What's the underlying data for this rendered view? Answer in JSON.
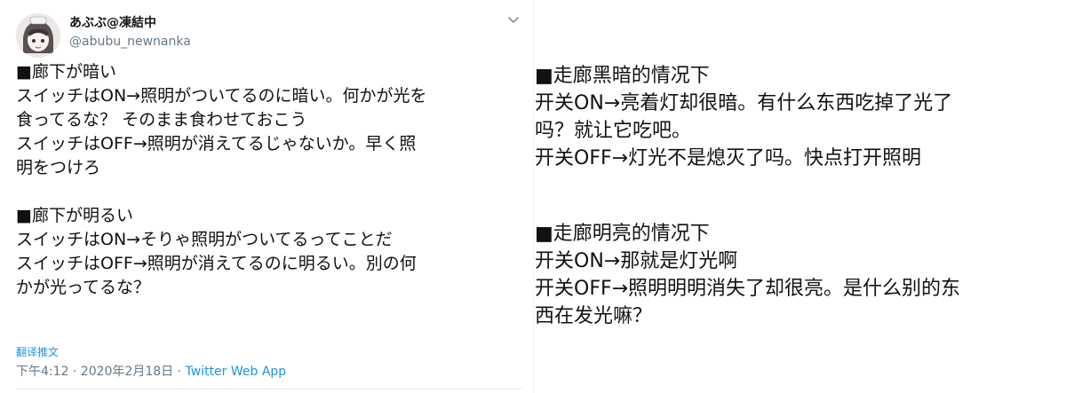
{
  "tweet": {
    "display_name": "あぶぶ@凍結中",
    "handle": "@abubu_newnanka",
    "lines_a": [
      "■廊下が暗い",
      "スイッチはON→照明がついてるのに暗い。何かが光を",
      "食ってるな？ そのまま食わせておこう",
      "スイッチはOFF→照明が消えてるじゃないか。早く照",
      "明をつけろ"
    ],
    "lines_b": [
      "■廊下が明るい",
      "スイッチはON→そりゃ照明がついてるってことだ",
      "スイッチはOFF→照明が消えてるのに明るい。別の何",
      "かが光ってるな？"
    ],
    "translate_label": "翻译推文",
    "timestamp": "下午4:12 · 2020年2月18日 · ",
    "source": "Twitter Web App",
    "icons": {
      "avatar": "avatar-image",
      "more": "chevron-down-icon"
    }
  },
  "translation": {
    "lines_a": [
      "■走廊黑暗的情况下",
      "开关ON→亮着灯却很暗。有什么东西吃掉了光了",
      "吗？就让它吃吧。",
      "开关OFF→灯光不是熄灭了吗。快点打开照明"
    ],
    "lines_b": [
      "■走廊明亮的情况下",
      "开关ON→那就是灯光啊",
      "开关OFF→照明明明消失了却很亮。是什么别的东",
      "西在发光嘛？"
    ]
  }
}
